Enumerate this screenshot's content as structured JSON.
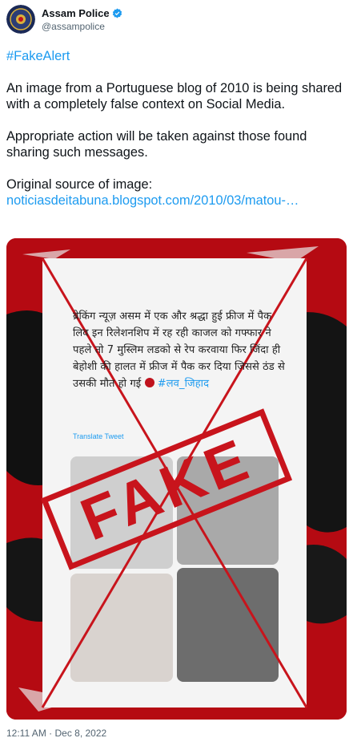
{
  "account": {
    "name": "Assam Police",
    "handle": "@assampolice"
  },
  "tweet": {
    "hashtag": "#FakeAlert",
    "paragraph1": "An image from a Portuguese blog of 2010 is being shared with a completely false context on Social Media.",
    "paragraph2": "Appropriate action will be taken against those found sharing such messages.",
    "source_label": "Original source of  image:",
    "source_link": "noticiasdeitabuna.blogspot.com/2010/03/matou-…"
  },
  "media": {
    "hindi_text": "ब्रेकिंग न्यूज़ असम में एक और श्रद्धा हुई फ्रीज में पैक लिव इन रिलेशनशिप में रह रही काजल को गफ्फार ने पहले तो  7 मुस्लिम लडको से रेप करवाया फिर जिंदा ही बेहोशी की हालत में फ्रीज में पैक कर दिया जिससे ठंड से उसकी मौत हो गई",
    "hindi_tag": "#लव_जिहाद",
    "translate_label": "Translate Tweet",
    "stamp": "FAKE"
  },
  "footer": {
    "timestamp": "12:11 AM · Dec 8, 2022"
  },
  "colors": {
    "link": "#1d9bf0",
    "stamp": "#c8141c",
    "media_background": "#b50a12"
  }
}
